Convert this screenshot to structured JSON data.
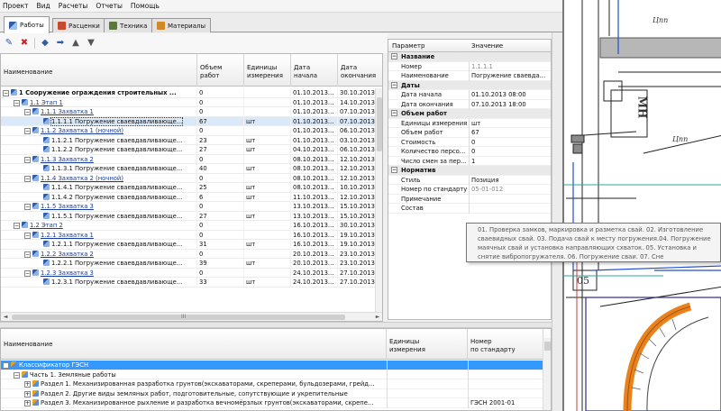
{
  "menu": [
    "Проект",
    "Вид",
    "Расчеты",
    "Отчеты",
    "Помощь"
  ],
  "tabs": [
    {
      "label": "Работы",
      "icon": "works-icon",
      "active": true
    },
    {
      "label": "Расценки",
      "icon": "rates-icon",
      "active": false
    },
    {
      "label": "Техника",
      "icon": "machinery-icon",
      "active": false
    },
    {
      "label": "Материалы",
      "icon": "materials-icon",
      "active": false
    }
  ],
  "toolbar": {
    "add": "✎",
    "delete": "✖",
    "left": "◆",
    "right": "➡",
    "up": "▲",
    "down": "▼"
  },
  "grid": {
    "headers": [
      "Наименование",
      "Объем\nработ",
      "Единицы\nизмерения",
      "Дата\nначала",
      "Дата\nокончания"
    ],
    "rows": [
      {
        "level": 0,
        "exp": "−",
        "icon": true,
        "name": "1 Сооружение ограждения строительных ...",
        "vol": "0",
        "unit": "",
        "start": "01.10.2013...",
        "end": "30.10.2013...",
        "style": "bold"
      },
      {
        "level": 1,
        "exp": "−",
        "icon": true,
        "name": "1.1 Этап 1",
        "vol": "0",
        "unit": "",
        "start": "01.10.2013...",
        "end": "14.10.2013...",
        "style": "link"
      },
      {
        "level": 2,
        "exp": "−",
        "icon": true,
        "name": "1.1.1 Захватка 1",
        "vol": "0",
        "unit": "",
        "start": "01.10.2013...",
        "end": "07.10.2013...",
        "style": "link"
      },
      {
        "level": 3,
        "exp": "",
        "icon": true,
        "name": "1.1.1.1 Погружение сваевдавливающе...",
        "vol": "67",
        "unit": "шт",
        "start": "01.10.2013...",
        "end": "07.10.2013...",
        "style": "sel"
      },
      {
        "level": 2,
        "exp": "−",
        "icon": true,
        "name": "1.1.2 Захватка 1 (ночной)",
        "vol": "0",
        "unit": "",
        "start": "01.10.2013...",
        "end": "06.10.2013...",
        "style": "link"
      },
      {
        "level": 3,
        "exp": "",
        "icon": true,
        "name": "1.1.2.1 Погружение сваевдавливающе...",
        "vol": "23",
        "unit": "шт",
        "start": "01.10.2013...",
        "end": "03.10.2013...",
        "style": ""
      },
      {
        "level": 3,
        "exp": "",
        "icon": true,
        "name": "1.1.2.2 Погружение сваевдавливающе...",
        "vol": "27",
        "unit": "шт",
        "start": "04.10.2013...",
        "end": "06.10.2013...",
        "style": ""
      },
      {
        "level": 2,
        "exp": "−",
        "icon": true,
        "name": "1.1.3 Захватка 2",
        "vol": "0",
        "unit": "",
        "start": "08.10.2013...",
        "end": "12.10.2013...",
        "style": "link"
      },
      {
        "level": 3,
        "exp": "",
        "icon": true,
        "name": "1.1.3.1 Погружение сваевдавливающе...",
        "vol": "40",
        "unit": "шт",
        "start": "08.10.2013...",
        "end": "12.10.2013...",
        "style": ""
      },
      {
        "level": 2,
        "exp": "−",
        "icon": true,
        "name": "1.1.4 Захватка 2 (ночной)",
        "vol": "0",
        "unit": "",
        "start": "08.10.2013...",
        "end": "12.10.2013...",
        "style": "link"
      },
      {
        "level": 3,
        "exp": "",
        "icon": true,
        "name": "1.1.4.1 Погружение сваевдавливающе...",
        "vol": "25",
        "unit": "шт",
        "start": "08.10.2013...",
        "end": "10.10.2013...",
        "style": ""
      },
      {
        "level": 3,
        "exp": "",
        "icon": true,
        "name": "1.1.4.2 Погружение сваевдавливающе...",
        "vol": "6",
        "unit": "шт",
        "start": "11.10.2013...",
        "end": "12.10.2013...",
        "style": ""
      },
      {
        "level": 2,
        "exp": "−",
        "icon": true,
        "name": "1.1.5 Захватка 3",
        "vol": "0",
        "unit": "",
        "start": "13.10.2013...",
        "end": "15.10.2013...",
        "style": "link"
      },
      {
        "level": 3,
        "exp": "",
        "icon": true,
        "name": "1.1.5.1 Погружение сваевдавливающе...",
        "vol": "27",
        "unit": "шт",
        "start": "13.10.2013...",
        "end": "15.10.2013...",
        "style": ""
      },
      {
        "level": 1,
        "exp": "−",
        "icon": true,
        "name": "1.2 Этап 2",
        "vol": "0",
        "unit": "",
        "start": "16.10.2013...",
        "end": "30.10.2013...",
        "style": "link"
      },
      {
        "level": 2,
        "exp": "−",
        "icon": true,
        "name": "1.2.1 Захватка 1",
        "vol": "0",
        "unit": "",
        "start": "16.10.2013...",
        "end": "19.10.2013...",
        "style": "link"
      },
      {
        "level": 3,
        "exp": "",
        "icon": true,
        "name": "1.2.1.1 Погружение сваевдавливающе...",
        "vol": "31",
        "unit": "шт",
        "start": "16.10.2013...",
        "end": "19.10.2013...",
        "style": ""
      },
      {
        "level": 2,
        "exp": "−",
        "icon": true,
        "name": "1.2.2 Захватка 2",
        "vol": "0",
        "unit": "",
        "start": "20.10.2013...",
        "end": "23.10.2013...",
        "style": "link"
      },
      {
        "level": 3,
        "exp": "",
        "icon": true,
        "name": "1.2.2.1 Погружение сваевдавливающе...",
        "vol": "39",
        "unit": "шт",
        "start": "20.10.2013...",
        "end": "23.10.2013...",
        "style": ""
      },
      {
        "level": 2,
        "exp": "−",
        "icon": true,
        "name": "1.2.3 Захватка 3",
        "vol": "0",
        "unit": "",
        "start": "24.10.2013...",
        "end": "27.10.2013...",
        "style": "link"
      },
      {
        "level": 3,
        "exp": "",
        "icon": true,
        "name": "1.2.3.1 Погружение сваевдавливающе...",
        "vol": "33",
        "unit": "шт",
        "start": "24.10.2013...",
        "end": "27.10.2013...",
        "style": ""
      }
    ],
    "hscroll_grip": "III",
    "scroll_left": "◄",
    "scroll_right": "►"
  },
  "props": {
    "headers": [
      "Параметр",
      "Значение"
    ],
    "rows": [
      {
        "cat": true,
        "key": "Название",
        "val": ""
      },
      {
        "cat": false,
        "key": "Номер",
        "val": "1.1.1.1",
        "grey": true
      },
      {
        "cat": false,
        "key": "Наименование",
        "val": "Погружение сваевда..."
      },
      {
        "cat": true,
        "key": "Даты",
        "val": ""
      },
      {
        "cat": false,
        "key": "Дата начала",
        "val": "01.10.2013 08:00"
      },
      {
        "cat": false,
        "key": "Дата окончания",
        "val": "07.10.2013 18:00"
      },
      {
        "cat": true,
        "key": "Объем работ",
        "val": ""
      },
      {
        "cat": false,
        "key": "Единицы измерения",
        "val": "шт"
      },
      {
        "cat": false,
        "key": "Объем работ",
        "val": "67"
      },
      {
        "cat": false,
        "key": "Стоимость",
        "val": "0"
      },
      {
        "cat": false,
        "key": "Количество персо...",
        "val": "0"
      },
      {
        "cat": false,
        "key": "Число смен за пер...",
        "val": "1"
      },
      {
        "cat": true,
        "key": "Норматив",
        "val": ""
      },
      {
        "cat": false,
        "key": "Стиль",
        "val": "Позиция"
      },
      {
        "cat": false,
        "key": "Номер по стандарту",
        "val": "05-01-012",
        "grey": true
      },
      {
        "cat": false,
        "key": "Примечание",
        "val": ""
      },
      {
        "cat": false,
        "key": "Состав",
        "val": ""
      }
    ]
  },
  "tooltip": "01. Проверка замков, маркировка и разметка свай. 02. Изготовление сваевидных свай. 03. Подача свай к месту погружения.04. Погружение маячных свай и установка направляющих схваток. 05. Установка и снятие вибропогружателя. 06. Погружение сваи. 07. Сне",
  "bottom": {
    "headers": [
      "Наименование",
      "Единицы\nизмерения",
      "Номер\nпо стандарту"
    ],
    "rows": [
      {
        "indent": 0,
        "exp": "−",
        "name": "Классификатор ГЭСН",
        "unit": "",
        "num": "",
        "sel": true
      },
      {
        "indent": 1,
        "exp": "−",
        "name": "Часть 1. Земляные работы",
        "unit": "",
        "num": "",
        "sel": false
      },
      {
        "indent": 2,
        "exp": "+",
        "name": "Раздел 1. Механизированная разработка грунтов(экскаваторами, скреперами, бульдозерами, грейд...",
        "unit": "",
        "num": "",
        "sel": false
      },
      {
        "indent": 2,
        "exp": "+",
        "name": "Раздел 2. Другие виды земляных работ, подготовительные, сопутствующие и укрепительные",
        "unit": "",
        "num": "",
        "sel": false
      },
      {
        "indent": 2,
        "exp": "+",
        "name": "Раздел 3. Механизированное рыхление и разработка вечномёрзлых грунтов(экскаваторами, скрепе...",
        "unit": "",
        "num": "ГЭСН 2001-01",
        "sel": false
      }
    ]
  },
  "cad": {
    "labels": [
      "Цпп",
      "Цпп",
      "МН",
      "05"
    ]
  }
}
